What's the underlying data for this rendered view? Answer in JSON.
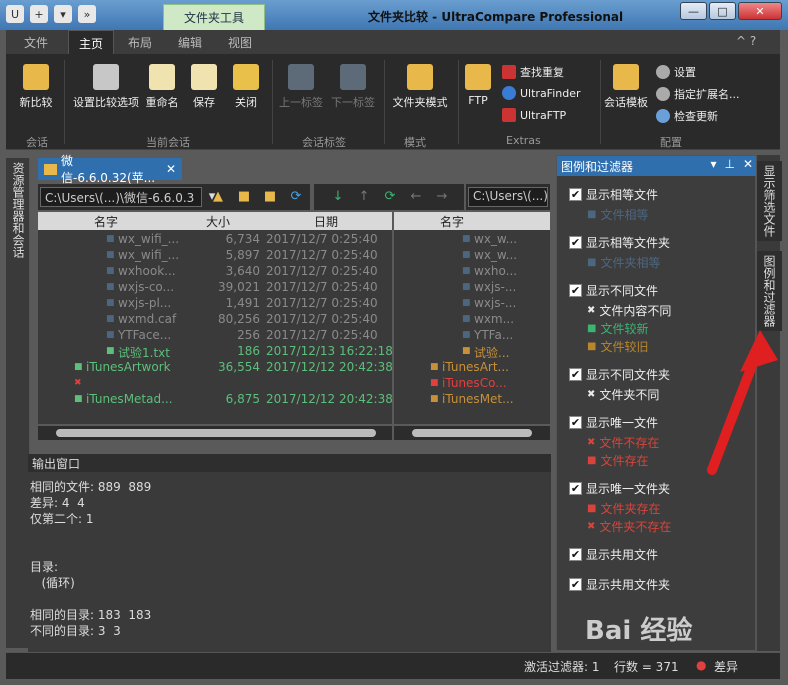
{
  "window": {
    "context_tab": "文件夹工具",
    "title": "文件夹比较 - UltraCompare Professional",
    "btn_min": "—",
    "btn_max": "□",
    "btn_close": "✕"
  },
  "ribbon_tabs": [
    "文件",
    "主页",
    "布局",
    "编辑",
    "视图"
  ],
  "ribbon_right": "^ ?",
  "ribbon": {
    "new_compare": "新比较",
    "setup_options": "设置比较选项",
    "rename": "重命名",
    "save": "保存",
    "close": "关闭",
    "prev_tab": "上一标签",
    "next_tab": "下一标签",
    "folder_mode": "文件夹模式",
    "ftp": "FTP",
    "find_dup": "查找重复",
    "ultrafinder": "UltraFinder",
    "ultraftp": "UltraFTP",
    "session_template": "会话模板",
    "settings": "设置",
    "assign_ext": "指定扩展名...",
    "check_update": "检查更新",
    "groups": [
      "会话",
      "当前会话",
      "会话标签",
      "模式",
      "Extras",
      "配置"
    ]
  },
  "left_strip": "资源管理器和会话",
  "doc_tab": "微信-6.6.0.32(苹...",
  "left_path": "C:\\Users\\(...)\\微信-6.6.0.3",
  "right_path": "C:\\Users\\(...)\\",
  "columns": {
    "name": "名字",
    "size": "大小",
    "date": "日期"
  },
  "rows": [
    {
      "name": "wx_wifi_...",
      "size": "6,734",
      "date": "2017/12/7 0:25:40",
      "rname": "wx_w...",
      "kind": "same"
    },
    {
      "name": "wx_wifi_...",
      "size": "5,897",
      "date": "2017/12/7 0:25:40",
      "rname": "wx_w...",
      "kind": "same"
    },
    {
      "name": "wxhook...",
      "size": "3,640",
      "date": "2017/12/7 0:25:40",
      "rname": "wxho...",
      "kind": "same"
    },
    {
      "name": "wxjs-co...",
      "size": "39,021",
      "date": "2017/12/7 0:25:40",
      "rname": "wxjs-...",
      "kind": "same"
    },
    {
      "name": "wxjs-pl...",
      "size": "1,491",
      "date": "2017/12/7 0:25:40",
      "rname": "wxjs-...",
      "kind": "same"
    },
    {
      "name": "wxmd.caf",
      "size": "80,256",
      "date": "2017/12/7 0:25:40",
      "rname": "wxm...",
      "kind": "same"
    },
    {
      "name": "YTFace...",
      "size": "256",
      "date": "2017/12/7 0:25:40",
      "rname": "YTFa...",
      "kind": "same"
    },
    {
      "name": "试验1.txt",
      "size": "186",
      "date": "2017/12/13 16:22:18",
      "rname": "试验...",
      "kind": "newer"
    },
    {
      "name": "iTunesArtwork",
      "size": "36,554",
      "date": "2017/12/12 20:42:38",
      "rname": "iTunesArt...",
      "kind": "newer_root"
    },
    {
      "name": "",
      "size": "",
      "date": "",
      "rname": "iTunesCo...",
      "kind": "missing"
    },
    {
      "name": "iTunesMetad...",
      "size": "6,875",
      "date": "2017/12/12 20:42:38",
      "rname": "iTunesMet...",
      "kind": "newer_root"
    }
  ],
  "output": {
    "header": "输出窗口",
    "lines": [
      "相同的文件: 889  889",
      "差异: 4  4",
      "仅第二个: 1",
      "",
      "",
      "目录:",
      "   (循环)",
      "",
      "相同的目录: 183  183",
      "不同的目录: 3  3"
    ]
  },
  "legend": {
    "title": "图例和过滤器",
    "items": [
      {
        "label": "显示相等文件",
        "subs": [
          {
            "text": "文件相等",
            "color": "#4d6680",
            "glyph": "■"
          }
        ]
      },
      {
        "label": "显示相等文件夹",
        "subs": [
          {
            "text": "文件夹相等",
            "color": "#4d6680",
            "glyph": "■"
          }
        ]
      },
      {
        "label": "显示不同文件",
        "subs": [
          {
            "text": "文件内容不同",
            "color": "#e8e8e8",
            "glyph": "✖"
          },
          {
            "text": "文件较新",
            "color": "#3cb371",
            "glyph": "■"
          },
          {
            "text": "文件较旧",
            "color": "#b8862c",
            "glyph": "■"
          }
        ]
      },
      {
        "label": "显示不同文件夹",
        "subs": [
          {
            "text": "文件夹不同",
            "color": "#e8e8e8",
            "glyph": "✖"
          }
        ]
      },
      {
        "label": "显示唯一文件",
        "subs": [
          {
            "text": "文件不存在",
            "color": "#d9443a",
            "glyph": "✖"
          },
          {
            "text": "文件存在",
            "color": "#d9443a",
            "glyph": "■"
          }
        ]
      },
      {
        "label": "显示唯一文件夹",
        "subs": [
          {
            "text": "文件夹存在",
            "color": "#d9443a",
            "glyph": "■"
          },
          {
            "text": "文件夹不存在",
            "color": "#d9443a",
            "glyph": "✖"
          }
        ]
      },
      {
        "label": "显示共用文件",
        "subs": []
      },
      {
        "label": "显示共用文件夹",
        "subs": []
      }
    ]
  },
  "right_strip": {
    "tab1": "显示筛选文件",
    "tab2": "图例和过滤器"
  },
  "status": {
    "filter": "激活过滤器: 1",
    "rows": "行数 = 371",
    "diff": "差异"
  },
  "watermark": "Bai 经验"
}
